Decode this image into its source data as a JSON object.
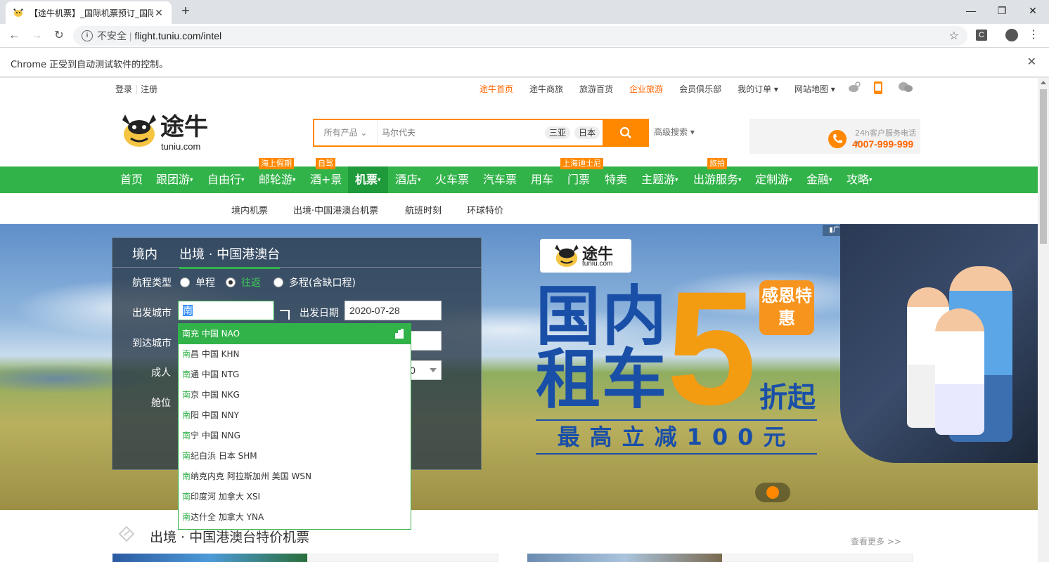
{
  "browser": {
    "tab_title": "【途牛机票】_国际机票预订_国际",
    "tab_close": "✕",
    "new_tab": "+",
    "win_min": "—",
    "win_max": "❐",
    "win_close": "✕",
    "back": "←",
    "forward": "→",
    "reload": "↻",
    "insecure": "不安全",
    "separator": "|",
    "url": "flight.tuniu.com/intel",
    "star": "☆",
    "ext_letter": "C",
    "menu": "⋮",
    "info_msg": "Chrome 正受到自动测试软件的控制。",
    "info_close": "✕"
  },
  "topnav": {
    "login": "登录",
    "divider": "|",
    "register": "注册",
    "links": [
      "途牛首页",
      "途牛商旅",
      "旅游百货",
      "企业旅游",
      "会员俱乐部",
      "我的订单 ▾",
      "网站地图 ▾"
    ]
  },
  "header": {
    "logo_text": "途牛",
    "logo_domain": "tuniu.com",
    "search_category": "所有产品 ⌄",
    "search_placeholder": "马尔代夫",
    "hot_tags": [
      "三亚",
      "日本"
    ],
    "advanced": "高级搜索 ▾",
    "hotline_label": "24h客户服务电话 ▾",
    "hotline_number": "4007-999-999"
  },
  "mainnav": {
    "items": [
      "首页",
      "跟团游",
      "自由行",
      "邮轮游",
      "酒+景",
      "机票",
      "酒店",
      "火车票",
      "汽车票",
      "用车",
      "门票",
      "特卖",
      "主题游",
      "出游服务",
      "定制游",
      "金融",
      "攻略"
    ],
    "arrow": "▾",
    "tags": {
      "cruise": "海上假期",
      "hotel_scene": "自驾",
      "ticket": "上海迪士尼",
      "service": "旅拍"
    }
  },
  "subnav": [
    "境内机票",
    "出境·中国港澳台机票",
    "航班时刻",
    "环球特价"
  ],
  "banner": {
    "ad": "▮广告",
    "logo_text": "途牛",
    "logo_domain": "tuniu.com",
    "line1": "国内",
    "line2": "租车",
    "five": "5",
    "bubble": "感恩特惠",
    "discount": "折起",
    "reduce": "最高立减100元"
  },
  "booking": {
    "tab_domestic": "境内",
    "tab_intl": "出境 · 中国港澳台",
    "trip_type_label": "航程类型",
    "trip_types": [
      "单程",
      "往返",
      "多程(含缺口程)"
    ],
    "from_label": "出发城市",
    "from_value": "南",
    "date_label": "出发日期",
    "date_value": "2020-07-28",
    "to_label": "到达城市",
    "adult_label": "成人",
    "adult_value": "0",
    "cabin_label": "舱位"
  },
  "dropdown": [
    {
      "hl": "南",
      "rest": "充 中国 NAO"
    },
    {
      "hl": "南",
      "rest": "昌 中国 KHN"
    },
    {
      "hl": "南",
      "rest": "通 中国 NTG"
    },
    {
      "hl": "南",
      "rest": "京 中国 NKG"
    },
    {
      "hl": "南",
      "rest": "阳 中国 NNY"
    },
    {
      "hl": "南",
      "rest": "宁 中国 NNG"
    },
    {
      "hl": "南",
      "rest": "纪白浜 日本 SHM"
    },
    {
      "hl": "南",
      "rest": "纳克内克 阿拉斯加州 美国 WSN"
    },
    {
      "hl": "南",
      "rest": "印度河 加拿大 XSI"
    },
    {
      "hl": "南",
      "rest": "达什全 加拿大 YNA"
    }
  ],
  "special": {
    "title": "出境 · 中国港澳台特价机票",
    "more": "查看更多 >>"
  },
  "colors": {
    "green": "#32b34a",
    "orange": "#ff8800",
    "blue": "#1a4fa8"
  }
}
